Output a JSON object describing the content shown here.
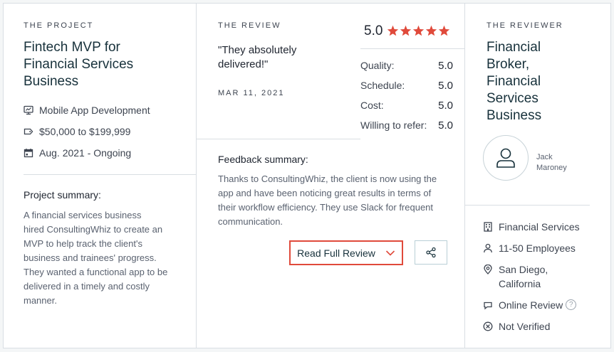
{
  "project": {
    "eyebrow": "THE PROJECT",
    "title_lines": [
      "Fintech MVP for",
      "Financial Services",
      "Business"
    ],
    "service": "Mobile App Development",
    "budget": "$50,000 to $199,999",
    "dates": "Aug. 2021 - Ongoing",
    "summary_label": "Project summary:",
    "summary_lines": [
      "A financial services business",
      "hired ConsultingWhiz to create an",
      "MVP to help track the client's",
      "business and trainees' progress.",
      "They wanted a functional app to be",
      "delivered in a timely and costly",
      "manner."
    ],
    "icons": {
      "service": "screen-icon",
      "budget": "price-tag-icon",
      "dates": "calendar-icon"
    }
  },
  "review": {
    "eyebrow": "THE REVIEW",
    "quote_lines": [
      "\"They absolutely",
      "delivered!\""
    ],
    "date": "MAR 11, 2021",
    "overall": "5.0",
    "stars": 5,
    "star_color": "#e04a3b",
    "scores": [
      {
        "label": "Quality:",
        "value": "5.0"
      },
      {
        "label": "Schedule:",
        "value": "5.0"
      },
      {
        "label": "Cost:",
        "value": "5.0"
      },
      {
        "label": "Willing to refer:",
        "value": "5.0"
      }
    ],
    "feedback_label": "Feedback summary:",
    "feedback_lines": [
      "Thanks to ConsultingWhiz, the client is now using the",
      "app and have been noticing great results in terms of",
      "their workflow efficiency. They use Slack for frequent",
      "communication."
    ],
    "read_full_label": "Read Full Review",
    "accent_color": "#e04a3b"
  },
  "reviewer": {
    "eyebrow": "THE REVIEWER",
    "title_lines": [
      "Financial",
      "Broker,",
      "Financial",
      "Services",
      "Business"
    ],
    "name_lines": [
      "Jack",
      "Maroney"
    ],
    "industry": "Financial Services",
    "size": "11-50 Employees",
    "location_lines": [
      "San Diego,",
      "California"
    ],
    "review_type": "Online Review",
    "help_glyph": "?",
    "verification": "Not Verified",
    "icons": {
      "industry": "building-icon",
      "size": "person-icon",
      "location": "map-pin-icon",
      "review_type": "chat-bubble-icon",
      "verification": "x-circle-icon"
    }
  }
}
